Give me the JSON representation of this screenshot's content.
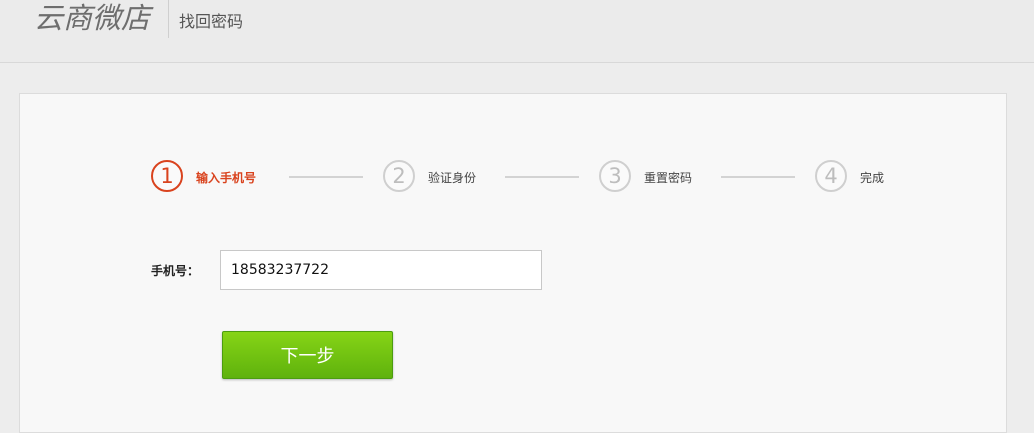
{
  "header": {
    "logo_text": "云商微店",
    "subtitle": "找回密码"
  },
  "steps": [
    {
      "number": "1",
      "label": "输入手机号",
      "state": "active"
    },
    {
      "number": "2",
      "label": "验证身份",
      "state": "pending"
    },
    {
      "number": "3",
      "label": "重置密码",
      "state": "pending"
    },
    {
      "number": "4",
      "label": "完成",
      "state": "pending"
    }
  ],
  "form": {
    "phone_label": "手机号：",
    "phone_value": "18583237722"
  },
  "actions": {
    "next_label": "下一步"
  },
  "colors": {
    "accent": "#d9431e",
    "button_green": "#6cc111",
    "inactive": "#cfcfcf"
  }
}
